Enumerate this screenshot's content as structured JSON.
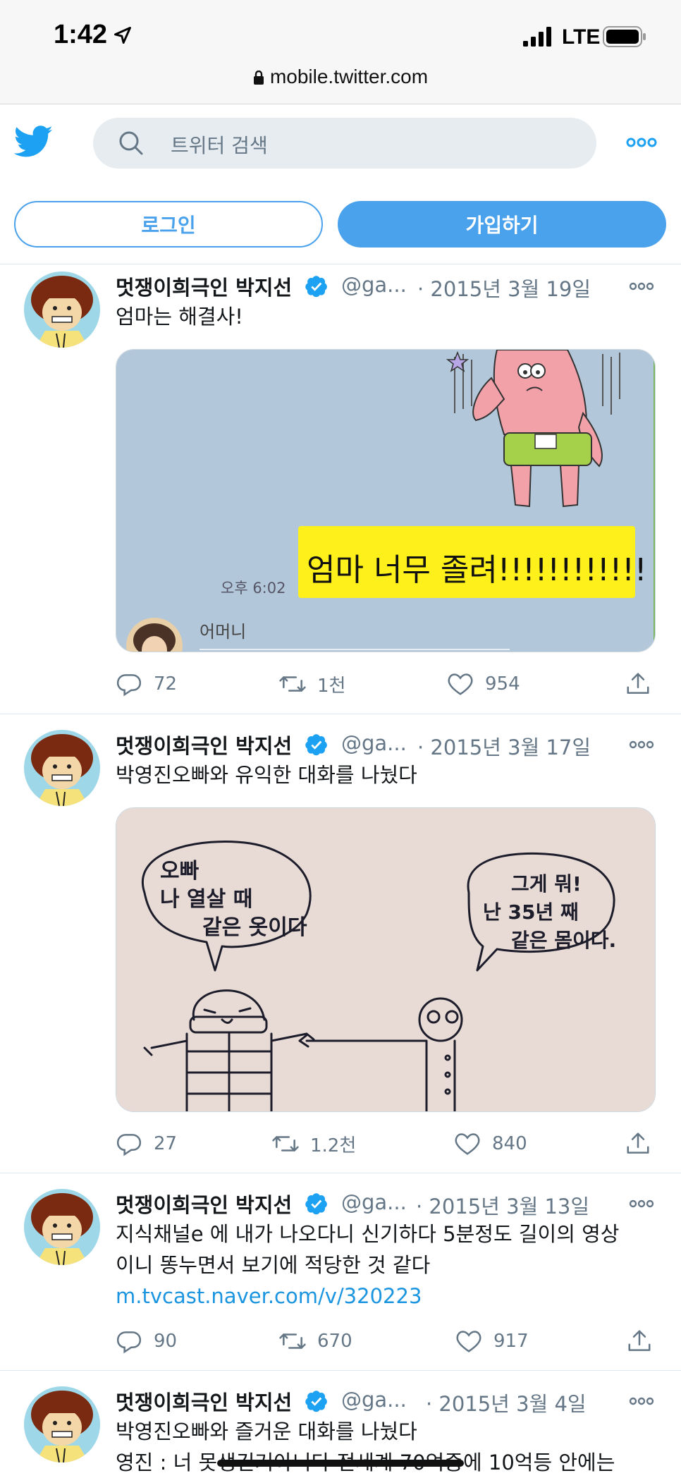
{
  "status_bar": {
    "time": "1:42",
    "network": "LTE",
    "url": "mobile.twitter.com"
  },
  "header": {
    "search_placeholder": "트위터 검색"
  },
  "auth": {
    "login_label": "로그인",
    "signup_label": "가입하기"
  },
  "colors": {
    "accent": "#4ba2ec",
    "text": "#14171a",
    "muted": "#657786",
    "link": "#1b95e0",
    "verified": "#1da1f2"
  },
  "tweets": [
    {
      "name": "멋쟁이희극인 박지선",
      "handle": "@ga...",
      "date": "· 2015년 3월 19일",
      "text": "엄마는 해결사!",
      "media": {
        "time_label": "오후 6:02",
        "bubble_text": "엄마 너무 졸려!!!!!!!!!!!!",
        "sender": "어머니"
      },
      "stats": {
        "replies": "72",
        "retweets": "1천",
        "likes": "954"
      }
    },
    {
      "name": "멋쟁이희극인 박지선",
      "handle": "@ga...",
      "date": "· 2015년 3월 17일",
      "text": "박영진오빠와 유익한 대화를 나눴다",
      "media": {
        "left_bubble": [
          "오빠",
          "나 열살 때",
          "같은 옷이다"
        ],
        "right_bubble": [
          "그게 뭐!",
          "난 35년 째",
          "같은 몸이다."
        ]
      },
      "stats": {
        "replies": "27",
        "retweets": "1.2천",
        "likes": "840"
      }
    },
    {
      "name": "멋쟁이희극인 박지선",
      "handle": "@ga...",
      "date": "· 2015년 3월 13일",
      "text_line1": "지식채널e 에 내가 나오다니 신기하다 5분정도 길이의 영상",
      "text_line2": "이니 똥누면서 보기에 적당한 것 같다",
      "link": "m.tvcast.naver.com/v/320223",
      "stats": {
        "replies": "90",
        "retweets": "670",
        "likes": "917"
      }
    },
    {
      "name": "멋쟁이희극인 박지선",
      "handle": "@ga...",
      "date": "· 2015년 3월 4일",
      "text": "박영진오빠와 즐거운 대화를 나눴다",
      "text_line2": "영진 : 너 못생긴거아니다 전세계 70억중에 10억등 안에는"
    }
  ]
}
